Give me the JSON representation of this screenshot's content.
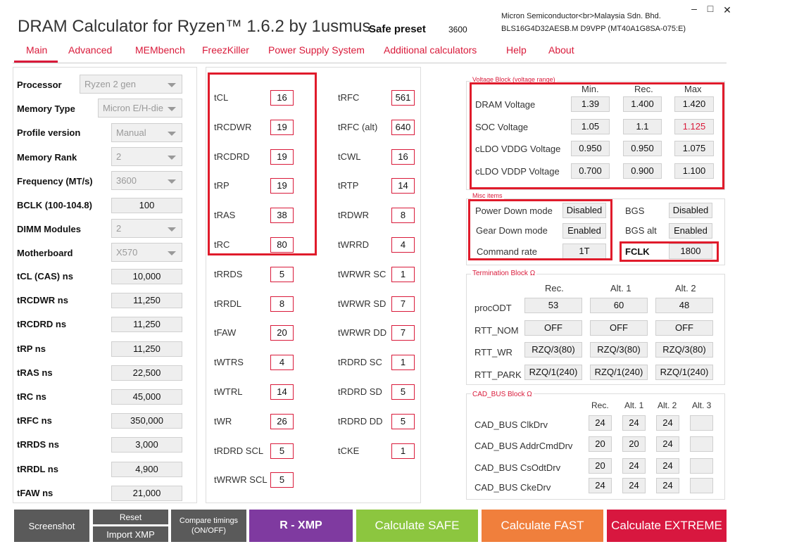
{
  "app": {
    "title": "DRAM Calculator for Ryzen™ 1.6.2 by 1usmus",
    "preset_label": "Safe preset",
    "preset_value": "3600",
    "chip_line1": "Micron Semiconductor<br>Malaysia Sdn. Bhd.",
    "chip_line2": "BLS16G4D32AESB.M D9VPP (MT40A1G8SA-075:E)"
  },
  "window": {
    "minimize": "–",
    "maximize": "□",
    "close": "✕"
  },
  "tabs": [
    "Main",
    "Advanced",
    "MEMbench",
    "FreezKiller",
    "Power Supply System",
    "Additional calculators",
    "Help",
    "About"
  ],
  "left": {
    "processor": {
      "label": "Processor",
      "value": "Ryzen 2 gen"
    },
    "memtype": {
      "label": "Memory Type",
      "value": "Micron E/H-die"
    },
    "profile": {
      "label": "Profile version",
      "value": "Manual"
    },
    "rank": {
      "label": "Memory Rank",
      "value": "2"
    },
    "freq": {
      "label": "Frequency (MT/s)",
      "value": "3600"
    },
    "bclk": {
      "label": "BCLK (100-104.8)",
      "value": "100"
    },
    "dimm": {
      "label": "DIMM Modules",
      "value": "2"
    },
    "mobo": {
      "label": "Motherboard",
      "value": "X570"
    },
    "ns": [
      {
        "label": "tCL (CAS) ns",
        "value": "10,000"
      },
      {
        "label": "tRCDWR ns",
        "value": "11,250"
      },
      {
        "label": "tRCDRD ns",
        "value": "11,250"
      },
      {
        "label": "tRP ns",
        "value": "11,250"
      },
      {
        "label": "tRAS ns",
        "value": "22,500"
      },
      {
        "label": "tRC ns",
        "value": "45,000"
      },
      {
        "label": "tRFC ns",
        "value": "350,000"
      },
      {
        "label": "tRRDS ns",
        "value": "3,000"
      },
      {
        "label": "tRRDL ns",
        "value": "4,900"
      },
      {
        "label": "tFAW ns",
        "value": "21,000"
      }
    ]
  },
  "timings_a": [
    {
      "label": "tCL",
      "value": "16"
    },
    {
      "label": "tRCDWR",
      "value": "19"
    },
    {
      "label": "tRCDRD",
      "value": "19"
    },
    {
      "label": "tRP",
      "value": "19"
    },
    {
      "label": "tRAS",
      "value": "38"
    },
    {
      "label": "tRC",
      "value": "80"
    },
    {
      "label": "tRRDS",
      "value": "5"
    },
    {
      "label": "tRRDL",
      "value": "8"
    },
    {
      "label": "tFAW",
      "value": "20"
    },
    {
      "label": "tWTRS",
      "value": "4"
    },
    {
      "label": "tWTRL",
      "value": "14"
    },
    {
      "label": "tWR",
      "value": "26"
    },
    {
      "label": "tRDRD SCL",
      "value": "5"
    },
    {
      "label": "tWRWR SCL",
      "value": "5"
    }
  ],
  "timings_b": [
    {
      "label": "tRFC",
      "value": "561"
    },
    {
      "label": "tRFC (alt)",
      "value": "640"
    },
    {
      "label": "tCWL",
      "value": "16"
    },
    {
      "label": "tRTP",
      "value": "14"
    },
    {
      "label": "tRDWR",
      "value": "8"
    },
    {
      "label": "tWRRD",
      "value": "4"
    },
    {
      "label": "tWRWR SC",
      "value": "1"
    },
    {
      "label": "tWRWR SD",
      "value": "7"
    },
    {
      "label": "tWRWR DD",
      "value": "7"
    },
    {
      "label": "tRDRD SC",
      "value": "1"
    },
    {
      "label": "tRDRD SD",
      "value": "5"
    },
    {
      "label": "tRDRD DD",
      "value": "5"
    },
    {
      "label": "tCKE",
      "value": "1"
    }
  ],
  "voltage": {
    "title": "Voltage Block (voltage range)",
    "headers": [
      "Min.",
      "Rec.",
      "Max"
    ],
    "rows": [
      {
        "label": "DRAM Voltage",
        "min": "1.39",
        "rec": "1.400",
        "max": "1.420"
      },
      {
        "label": "SOC Voltage",
        "min": "1.05",
        "rec": "1.1",
        "max": "1.125"
      },
      {
        "label": "cLDO VDDG Voltage",
        "min": "0.950",
        "rec": "0.950",
        "max": "1.075"
      },
      {
        "label": "cLDO VDDP Voltage",
        "min": "0.700",
        "rec": "0.900",
        "max": "1.100"
      }
    ]
  },
  "misc": {
    "title": "Misc items",
    "powerdown": {
      "label": "Power Down mode",
      "value": "Disabled"
    },
    "geardown": {
      "label": "Gear Down mode",
      "value": "Enabled"
    },
    "cmdrate": {
      "label": "Command rate",
      "value": "1T"
    },
    "bgs": {
      "label": "BGS",
      "value": "Disabled"
    },
    "bgsalt": {
      "label": "BGS alt",
      "value": "Enabled"
    },
    "fclk": {
      "label": "FCLK",
      "value": "1800"
    }
  },
  "term": {
    "title": "Termination Block Ω",
    "headers": [
      "Rec.",
      "Alt. 1",
      "Alt. 2"
    ],
    "rows": [
      {
        "label": "procODT",
        "v": [
          "53",
          "60",
          "48"
        ]
      },
      {
        "label": "RTT_NOM",
        "v": [
          "OFF",
          "OFF",
          "OFF"
        ]
      },
      {
        "label": "RTT_WR",
        "v": [
          "RZQ/3(80)",
          "RZQ/3(80)",
          "RZQ/3(80)"
        ]
      },
      {
        "label": "RTT_PARK",
        "v": [
          "RZQ/1(240)",
          "RZQ/1(240)",
          "RZQ/1(240)"
        ]
      }
    ]
  },
  "cad": {
    "title": "CAD_BUS Block Ω",
    "headers": [
      "Rec.",
      "Alt. 1",
      "Alt. 2",
      "Alt. 3"
    ],
    "rows": [
      {
        "label": "CAD_BUS ClkDrv",
        "v": [
          "24",
          "24",
          "24",
          ""
        ]
      },
      {
        "label": "CAD_BUS AddrCmdDrv",
        "v": [
          "20",
          "20",
          "24",
          ""
        ]
      },
      {
        "label": "CAD_BUS CsOdtDrv",
        "v": [
          "20",
          "24",
          "24",
          ""
        ]
      },
      {
        "label": "CAD_BUS CkeDrv",
        "v": [
          "24",
          "24",
          "24",
          ""
        ]
      }
    ]
  },
  "buttons": {
    "screenshot": "Screenshot",
    "reset": "Reset",
    "import": "Import XMP",
    "compare1": "Compare timings",
    "compare2": "(ON/OFF)",
    "rxmp": "R - XMP",
    "safe": "Calculate SAFE",
    "fast": "Calculate FAST",
    "extreme": "Calculate EXTREME"
  },
  "colors": {
    "accent": "#d91a3a",
    "xmp": "#7f3aa0",
    "safe": "#8cc63f",
    "fast": "#f07f3c",
    "extreme": "#d8173f",
    "dark": "#5a5a5a",
    "highlight": "#e01b2b"
  }
}
